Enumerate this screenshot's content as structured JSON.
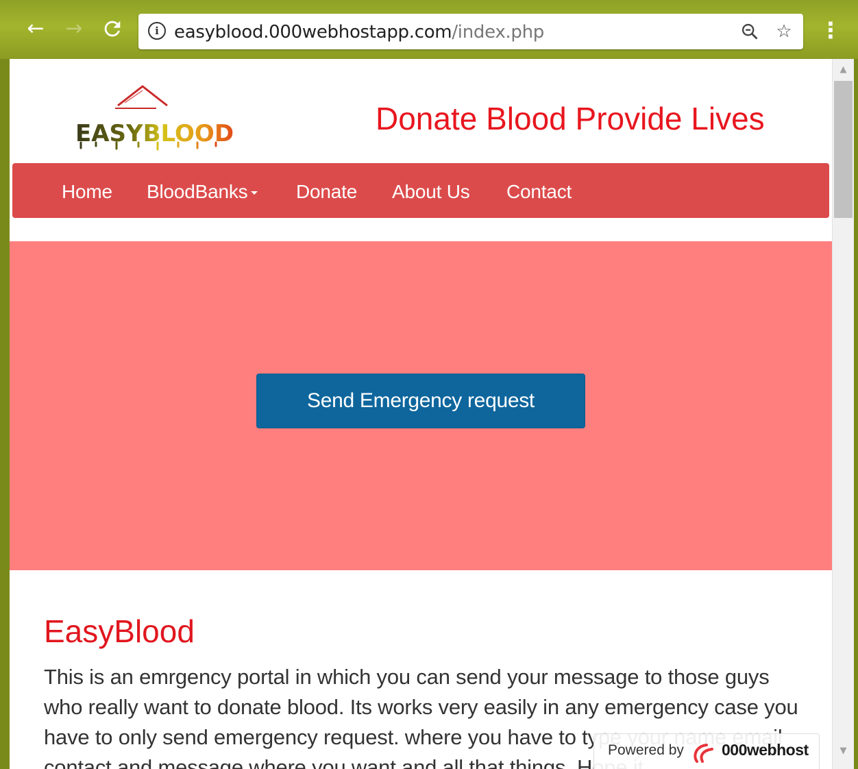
{
  "browser": {
    "back_icon": "←",
    "forward_icon": "→",
    "reload_icon": "C",
    "url_domain": "easyblood.000webhostapp.com",
    "url_path": "/index.php",
    "zoom_icon": "🔍",
    "star_icon": "☆",
    "menu_icon": "⋮"
  },
  "site": {
    "logo_text": "EASYBLOOD",
    "tagline": "Donate Blood Provide Lives"
  },
  "nav": {
    "items": [
      {
        "label": "Home"
      },
      {
        "label": "BloodBanks"
      },
      {
        "label": "Donate"
      },
      {
        "label": "About Us"
      },
      {
        "label": "Contact"
      }
    ]
  },
  "hero": {
    "button_label": "Send Emergency request"
  },
  "about": {
    "title": "EasyBlood",
    "text": "This is an emrgency portal in which you can send your message to those guys who really want to donate blood. Its works very easily in any emergency case you have to only send emergency request. where you have to type your name email contact and message where you want and all that things. Hope it"
  },
  "powered": {
    "label": "Powered by",
    "brand": "000webhost"
  },
  "colors": {
    "navbar": "#dc4b4b",
    "hero_bg": "#ff7f7f",
    "button": "#0e669d",
    "tagline": "#e8161e"
  }
}
